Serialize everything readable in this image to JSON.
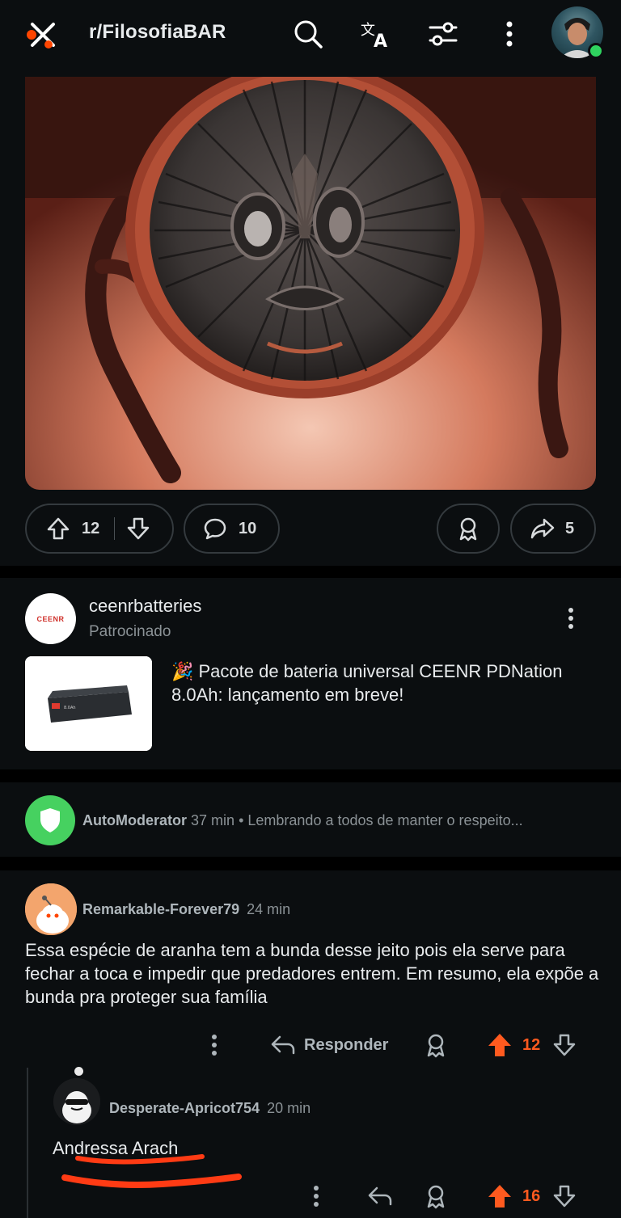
{
  "header": {
    "subreddit": "r/FilosofiaBAR",
    "icons": [
      "close-brand-icon",
      "search-icon",
      "translate-icon",
      "filter-icon",
      "more-vertical-icon"
    ]
  },
  "post": {
    "upvotes": "12",
    "comments": "10",
    "shares": "5"
  },
  "ad": {
    "logo_text": "CEENR",
    "advertiser": "ceenrbatteries",
    "label": "Patrocinado",
    "headline": "🎉 Pacote de bateria universal CEENR PDNation 8.0Ah: lançamento em breve!",
    "product_label": "8.0Ah"
  },
  "automod": {
    "user": "AutoModerator",
    "time": "37 min",
    "separator": "•",
    "preview": "Lembrando a todos de manter o respeito..."
  },
  "comment": {
    "user": "Remarkable-Forever79",
    "time": "24 min",
    "body": "Essa espécie de aranha tem a bunda desse jeito pois ela serve para fechar a toca e impedir que predadores entrem. Em resumo, ela expõe a bunda pra proteger sua família",
    "reply_label": "Responder",
    "score": "12"
  },
  "reply": {
    "user": "Desperate-Apricot754",
    "time": "20 min",
    "body": "Andressa Arach",
    "score": "16"
  },
  "colors": {
    "background": "#0b0e10",
    "accent_upvote": "#ff5a1f",
    "online": "#2fd35f",
    "automod_green": "#46d160",
    "annotation_red": "#ff3b14"
  }
}
